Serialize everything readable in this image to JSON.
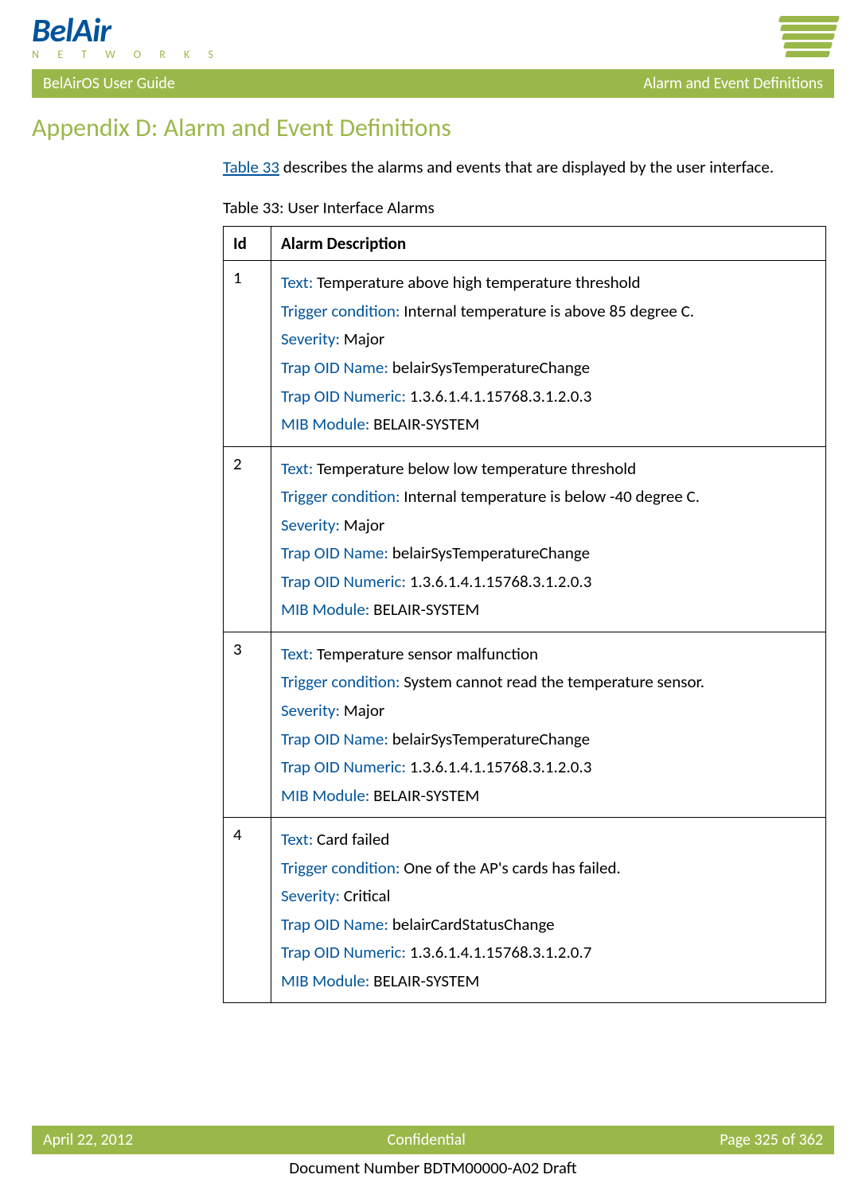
{
  "logo": {
    "brand": "BelAir",
    "sub": "N E T W O R K S"
  },
  "titlebar": {
    "left": "BelAirOS User Guide",
    "right": "Alarm and Event Definitions"
  },
  "appendix_title": "Appendix D: Alarm and Event Definitions",
  "intro": {
    "link": "Table 33",
    "rest": " describes the alarms and events that are displayed by the user interface."
  },
  "table_caption": "Table 33: User Interface Alarms",
  "headers": {
    "id": "Id",
    "desc": "Alarm Description"
  },
  "labels": {
    "text": "Text:",
    "trigger": "Trigger condition:",
    "severity": "Severity:",
    "trap_name": "Trap OID Name:",
    "trap_num": "Trap OID Numeric:",
    "mib": "MIB Module:"
  },
  "rows": [
    {
      "id": "1",
      "text": "  Temperature above high temperature threshold",
      "trigger": " Internal temperature is above 85 degree C.",
      "severity": " Major",
      "trap_name": " belairSysTemperatureChange",
      "trap_num": " 1.3.6.1.4.1.15768.3.1.2.0.3",
      "mib": " BELAIR-SYSTEM"
    },
    {
      "id": "2",
      "text": " Temperature below low temperature threshold",
      "trigger": " Internal temperature is below -40 degree C.",
      "severity": " Major",
      "trap_name": " belairSysTemperatureChange",
      "trap_num": " 1.3.6.1.4.1.15768.3.1.2.0.3",
      "mib": " BELAIR-SYSTEM"
    },
    {
      "id": "3",
      "text": " Temperature sensor malfunction",
      "trigger": " System cannot read the temperature sensor.",
      "severity": " Major",
      "trap_name": " belairSysTemperatureChange",
      "trap_num": " 1.3.6.1.4.1.15768.3.1.2.0.3",
      "mib": " BELAIR-SYSTEM"
    },
    {
      "id": "4",
      "text": " Card failed",
      "trigger": " One of the AP's cards has failed.",
      "severity": " Critical",
      "trap_name": " belairCardStatusChange",
      "trap_num": " 1.3.6.1.4.1.15768.3.1.2.0.7",
      "mib": " BELAIR-SYSTEM"
    }
  ],
  "footer": {
    "date": "April 22, 2012",
    "conf": "Confidential",
    "page": "Page 325 of 362",
    "docnum": "Document Number BDTM00000-A02 Draft"
  }
}
